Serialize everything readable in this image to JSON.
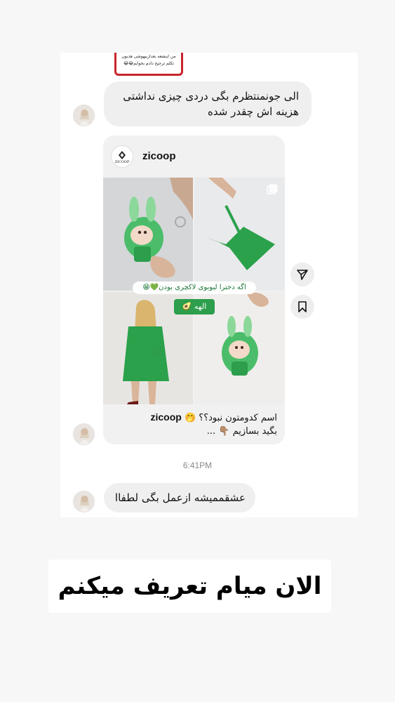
{
  "quoted_story": {
    "text_line1": "من اینشعه بعدازبیهوشی هذیون",
    "text_line2": "تکلم ترجیح دادم بخوابم😂😂"
  },
  "messages": {
    "first": {
      "line1": "الی جونمنتظرم بگی دردی چیزی نداشتی",
      "line2": "هزینه اش چقدر شده"
    },
    "last": "عشقممیشه ازعمل بگی لطفاا"
  },
  "shared_post": {
    "username": "zicoop",
    "logo_text": "ZICOOP",
    "image_banner": "اگه دخترا لبوبوی لاکچری بودن💚😁",
    "image_tag": "الهه 🥑",
    "caption_user": "zicoop",
    "caption_line1": "اسم کدومتون نبود؟؟ 🤭",
    "caption_line2": "بگید بسازیم 👇🏽 ..."
  },
  "timestamp": "6:41PM",
  "overlay_text": "الان میام تعریف میکنم",
  "icons": {
    "share": "paper-plane-icon",
    "save": "bookmark-icon",
    "multi": "carousel-icon"
  },
  "colors": {
    "bubble": "#efefef",
    "green": "#2c9e4c",
    "story_border": "#c7262c"
  }
}
